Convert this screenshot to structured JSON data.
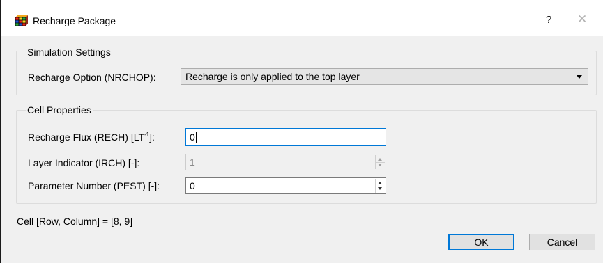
{
  "window": {
    "title": "Recharge Package",
    "help_label": "?",
    "close_label": "✕"
  },
  "simulation_settings": {
    "group_title": "Simulation Settings",
    "recharge_option_label": "Recharge Option (NRCHOP):",
    "recharge_option_value": "Recharge is only applied to the top layer"
  },
  "cell_properties": {
    "group_title": "Cell Properties",
    "recharge_flux_label_prefix": "Recharge Flux (RECH) [LT",
    "recharge_flux_label_sup": "-1",
    "recharge_flux_label_suffix": "]:",
    "recharge_flux_value": "0",
    "layer_indicator_label": "Layer Indicator (IRCH) [-]:",
    "layer_indicator_value": "1",
    "parameter_number_label": "Parameter Number (PEST) [-]:",
    "parameter_number_value": "0"
  },
  "status": {
    "cell_info": "Cell [Row, Column] = [8, 9]"
  },
  "buttons": {
    "ok_label": "OK",
    "cancel_label": "Cancel"
  },
  "colors": {
    "accent": "#0078d7",
    "client_background": "#f0f0f0"
  }
}
